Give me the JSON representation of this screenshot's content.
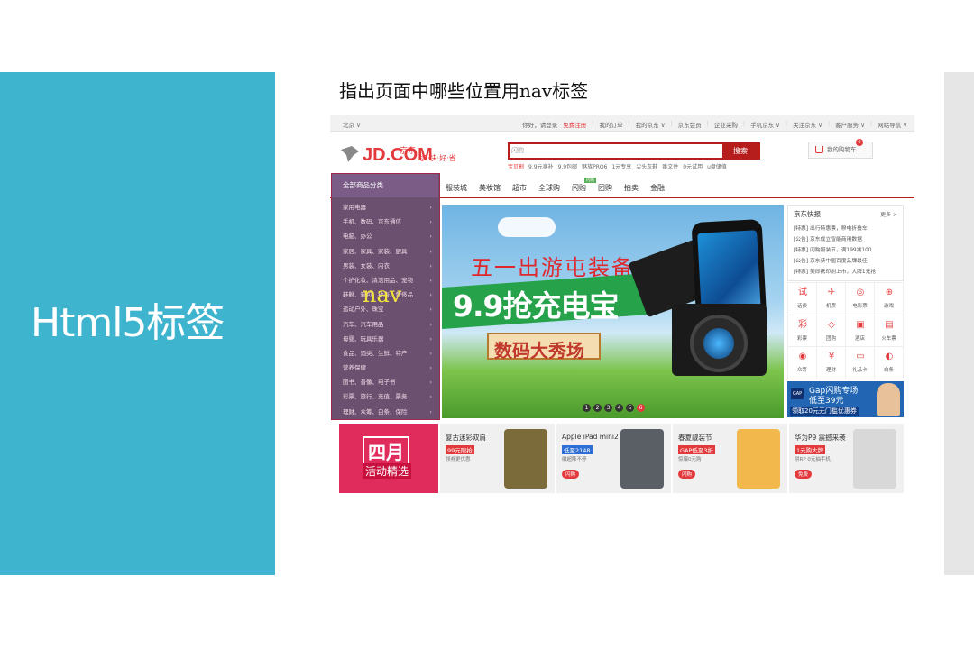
{
  "slide": {
    "title": "Html5标签",
    "heading": "指出页面中哪些位置用nav标签",
    "overlay_label": "nav"
  },
  "screenshot": {
    "topbar": {
      "location": "北京 ∨",
      "links": [
        "你好，请登录",
        "免费注册",
        "|",
        "我的订单",
        "|",
        "我的京东 ∨",
        "|",
        "京东会员",
        "|",
        "企业采购",
        "|",
        "手机京东 ∨",
        "|",
        "关注京东 ∨",
        "|",
        "客户服务 ∨",
        "|",
        "网站导航 ∨"
      ]
    },
    "logo": {
      "brand": "JD.COM",
      "brand_cn": "京东",
      "slogan": "多·快·好·省"
    },
    "search": {
      "placeholder": "闪购",
      "button": "搜索"
    },
    "hotwords": [
      "宝贝割",
      "9.9元身补",
      "9.9包邮",
      "魅族PRO6",
      "1元专享",
      "尖头灰鞋",
      "番文件",
      "0元试用",
      "u盘储值"
    ],
    "cart": {
      "label": "我的购物车",
      "count": "0"
    },
    "nav_tag": "闪购",
    "main_nav": [
      "服装城",
      "美妆馆",
      "超市",
      "全球购",
      "闪购",
      "团购",
      "拍卖",
      "金融"
    ],
    "category_nav": {
      "header": "全部商品分类",
      "items": [
        "家用电器",
        "手机、数码、京东通信",
        "电脑、办公",
        "家居、家具、家装、厨具",
        "男装、女装、内衣",
        "个护化妆、清洁用品、宠物",
        "鞋靴、箱包、钟表、奢侈品",
        "运动户外、珠宝",
        "汽车、汽车用品",
        "母婴、玩具乐器",
        "食品、酒类、生鲜、特产",
        "营养保健",
        "图书、音像、电子书",
        "彩票、旅行、充值、票务",
        "理财、众筹、白条、保险"
      ]
    },
    "banner": {
      "line1": "五一出游屯装备",
      "line2": "9.9抢充电宝",
      "line3": "数码大秀场",
      "dots": [
        "1",
        "2",
        "3",
        "4",
        "5",
        "6"
      ]
    },
    "news": {
      "title": "京东快报",
      "more": "更多 >",
      "items": [
        "[特惠] 出行特惠票，穆电折叠车",
        "[公告] 京东成立智能商用数据",
        "[特惠] 闪购服装节，满199减100",
        "[公告] 京东获中国百度品牌最佳",
        "[特惠] 美即携印刷上市，大牌1元抢"
      ]
    },
    "services": [
      {
        "icon": "试",
        "label": "话费"
      },
      {
        "icon": "✈",
        "label": "机票"
      },
      {
        "icon": "◎",
        "label": "电影票"
      },
      {
        "icon": "⊕",
        "label": "游戏"
      },
      {
        "icon": "彩",
        "label": "彩票"
      },
      {
        "icon": "◇",
        "label": "团购"
      },
      {
        "icon": "▣",
        "label": "酒店"
      },
      {
        "icon": "▤",
        "label": "火车票"
      },
      {
        "icon": "◉",
        "label": "众筹"
      },
      {
        "icon": "¥",
        "label": "理财"
      },
      {
        "icon": "▭",
        "label": "礼品卡"
      },
      {
        "icon": "◐",
        "label": "白条"
      }
    ],
    "gap_ad": {
      "logo": "GAP",
      "line1": "Gap闪购专场",
      "line2": "低至39元",
      "line3": "领取20元无门槛优惠券"
    },
    "april": {
      "line1": "四月",
      "line2": "活动精选"
    },
    "promos": [
      {
        "title": "复古迷彩双肩",
        "tag": "99元限抢",
        "sub": "领券更优惠",
        "btn": "",
        "color": "#e4393c",
        "pic": "#7b6a3a"
      },
      {
        "title": "Apple iPad mini2",
        "tag": "低至2148",
        "sub": "缴超降不停",
        "btn": "闪购",
        "color": "#2d6fd6",
        "pic": "#5a5f66"
      },
      {
        "title": "春夏靓装节",
        "tag": "GAP低至3折",
        "sub": "惊爆0元购",
        "btn": "闪购",
        "color": "#e4393c",
        "pic": "#f2b84b"
      },
      {
        "title": "华为P9 震撼来袭",
        "tag": "1元购大牌",
        "sub": "拼RP 0元抽手机",
        "btn": "免费",
        "color": "#e4393c",
        "pic": "#d8d8d8"
      }
    ]
  }
}
